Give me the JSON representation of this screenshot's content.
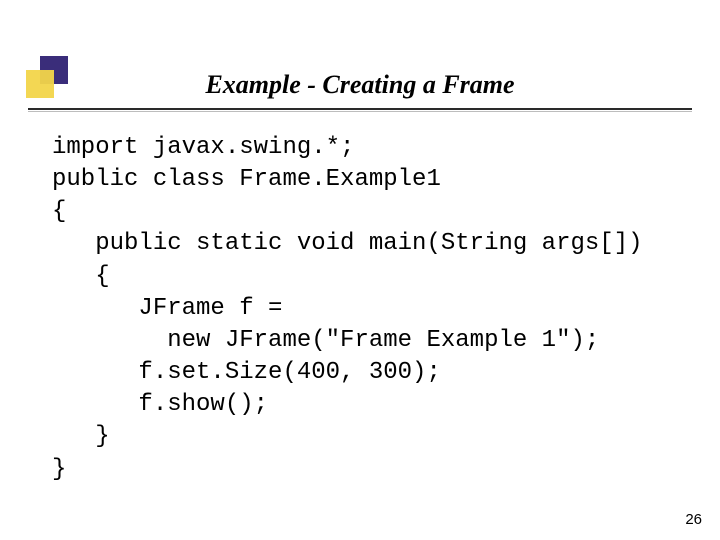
{
  "title": "Example - Creating a Frame",
  "code": {
    "l01": "import javax.swing.*;",
    "l02": "public class Frame.Example1",
    "l03": "{",
    "l04": "   public static void main(String args[])",
    "l05": "   {",
    "l06": "      JFrame f =",
    "l07": "        new JFrame(\"Frame Example 1\");",
    "l08": "      f.set.Size(400, 300);",
    "l09": "      f.show();",
    "l10": "   }",
    "l11": "}"
  },
  "page_number": "26"
}
